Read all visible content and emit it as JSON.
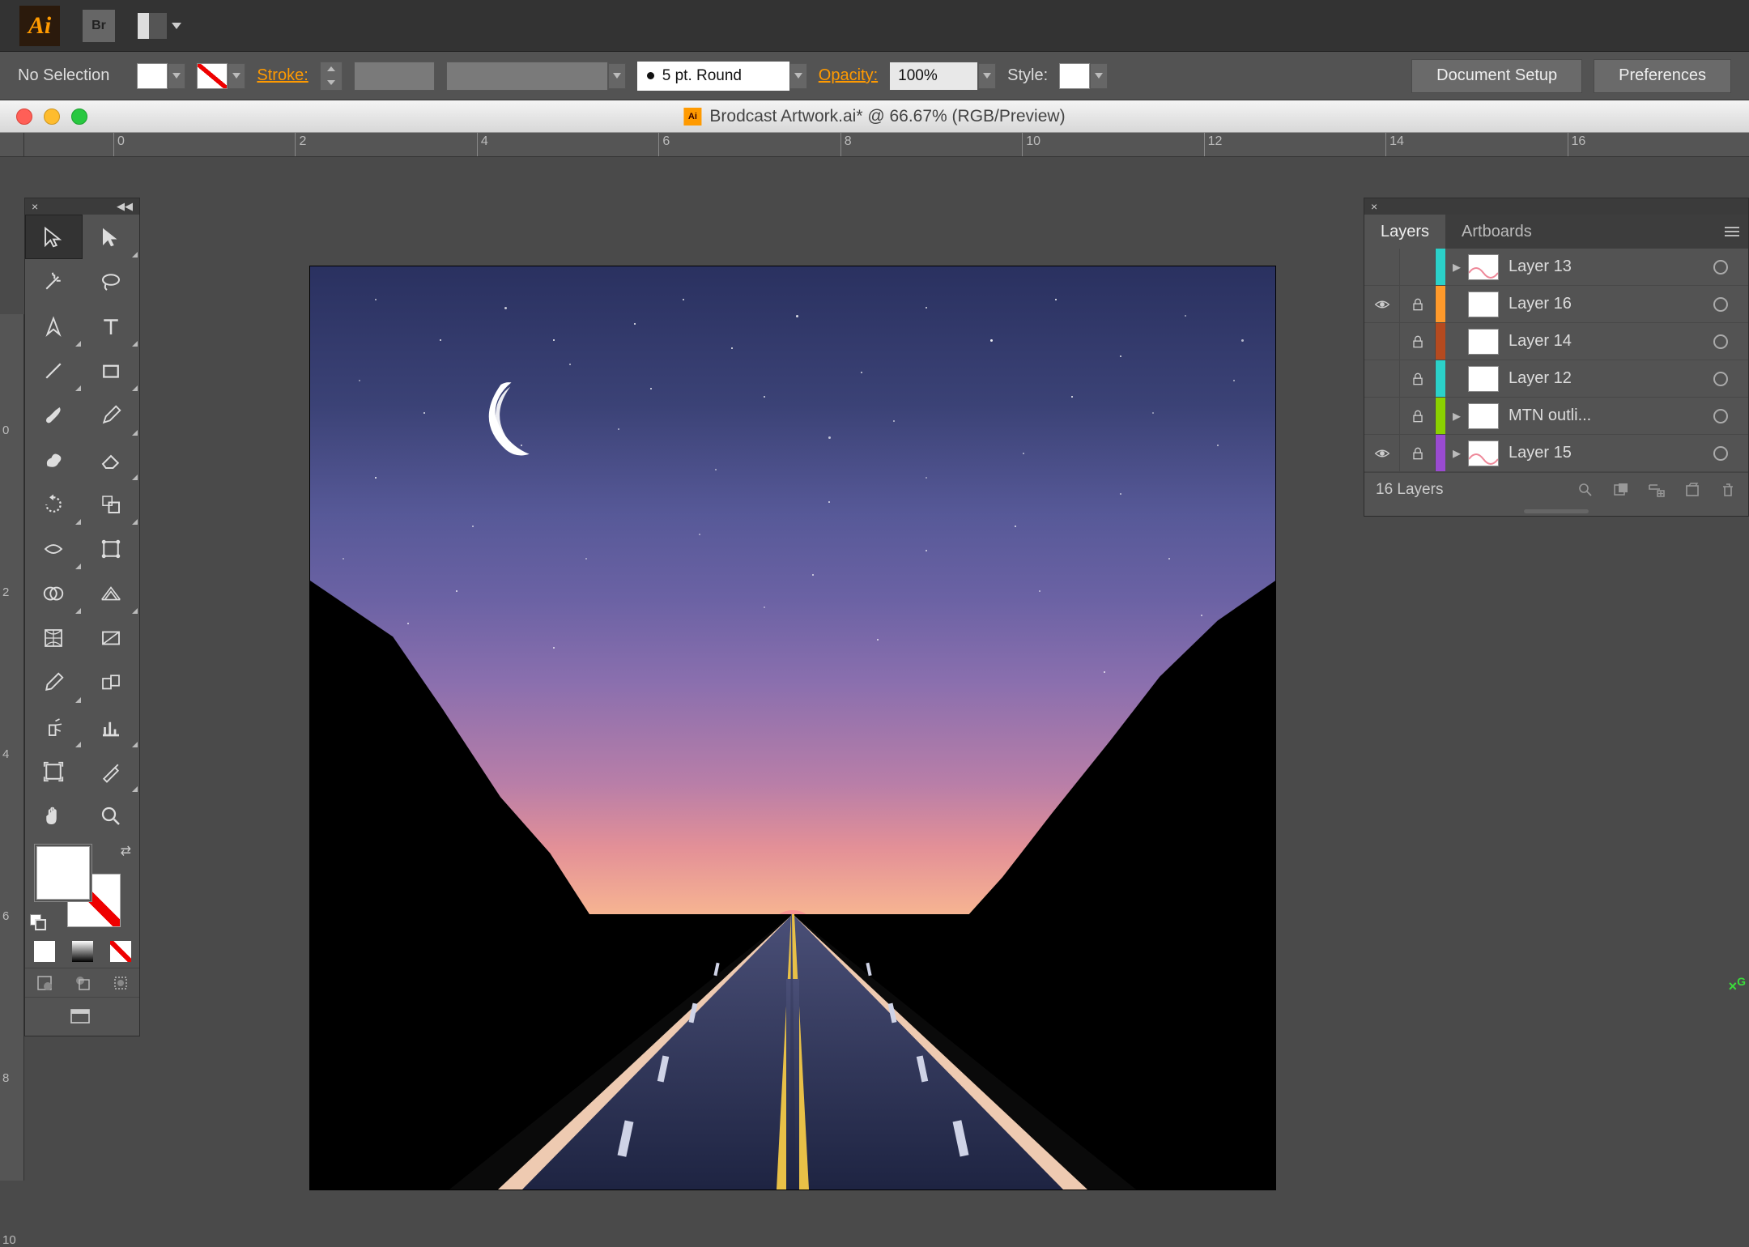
{
  "app": "Adobe Illustrator",
  "menu_bar": {
    "br_label": "Br"
  },
  "control_bar": {
    "selection_label": "No Selection",
    "stroke_label": "Stroke:",
    "cap_value": "5 pt. Round",
    "opacity_label": "Opacity:",
    "opacity_value": "100%",
    "style_label": "Style:",
    "doc_setup_btn": "Document Setup",
    "preferences_btn": "Preferences"
  },
  "document": {
    "title": "Brodcast Artwork.ai* @ 66.67% (RGB/Preview)"
  },
  "ruler_h": [
    "0",
    "2",
    "4",
    "6",
    "8",
    "10",
    "12",
    "14",
    "16"
  ],
  "ruler_v": [
    "0",
    "2",
    "4",
    "6",
    "8",
    "10"
  ],
  "layers_panel": {
    "tab_layers": "Layers",
    "tab_artboards": "Artboards",
    "rows": [
      {
        "visible": false,
        "locked": false,
        "color": "#2bd1c9",
        "expand": true,
        "thumb": "wave-pink",
        "name": "Layer 13"
      },
      {
        "visible": true,
        "locked": true,
        "color": "#ff9a2b",
        "expand": false,
        "thumb": "blank",
        "name": "Layer 16"
      },
      {
        "visible": false,
        "locked": true,
        "color": "#b54a1f",
        "expand": false,
        "thumb": "blank",
        "name": "Layer 14"
      },
      {
        "visible": false,
        "locked": true,
        "color": "#2bd1c9",
        "expand": false,
        "thumb": "blank",
        "name": "Layer 12"
      },
      {
        "visible": false,
        "locked": true,
        "color": "#8ad100",
        "expand": true,
        "thumb": "blank",
        "name": "MTN outli..."
      },
      {
        "visible": true,
        "locked": true,
        "color": "#9a4bd1",
        "expand": true,
        "thumb": "wave-pink",
        "name": "Layer 15"
      }
    ],
    "footer_count": "16 Layers"
  }
}
